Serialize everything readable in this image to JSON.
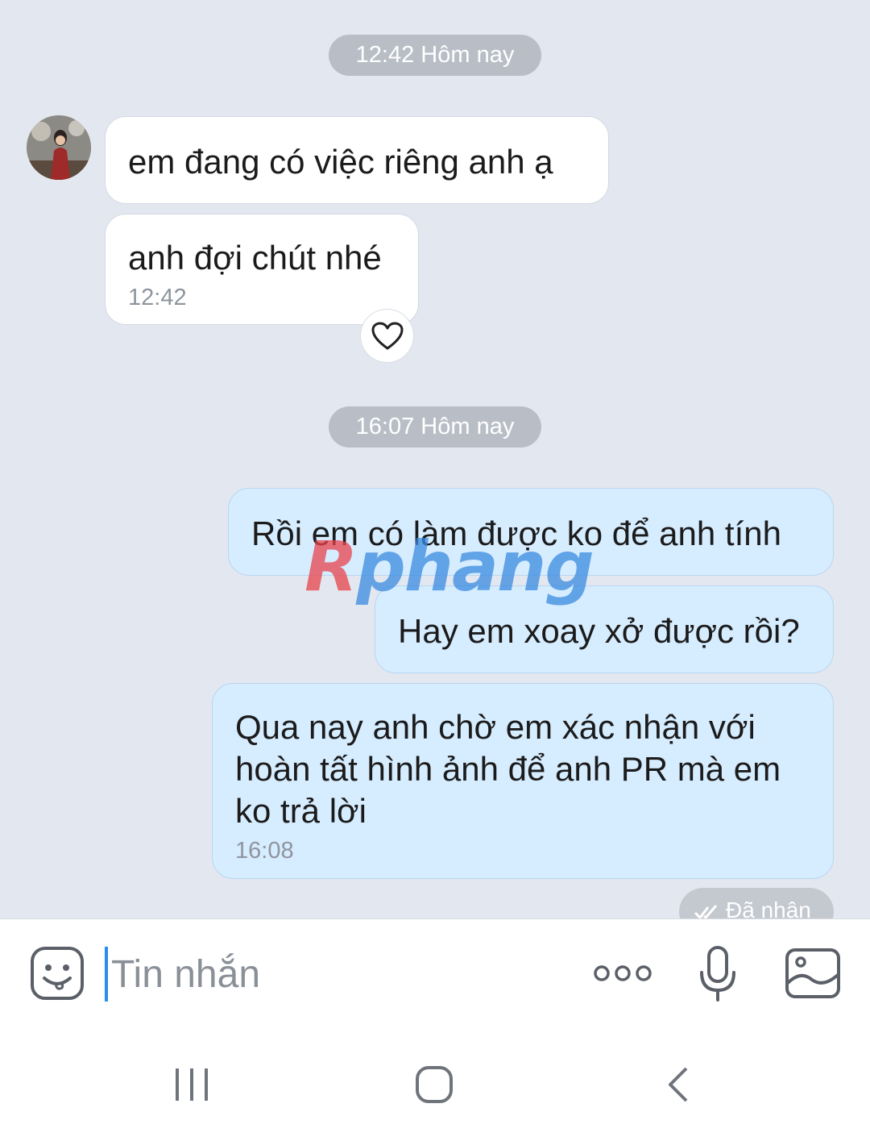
{
  "chat": {
    "separators": [
      {
        "label": "12:42 Hôm nay"
      },
      {
        "label": "16:07 Hôm nay"
      }
    ],
    "incoming": [
      {
        "text": "em đang có việc riêng anh ạ"
      },
      {
        "text": "anh đợi chút nhé",
        "time": "12:42"
      }
    ],
    "outgoing": [
      {
        "text": "Rồi em có làm được ko để anh tính"
      },
      {
        "text": "Hay em xoay xở được rồi?"
      },
      {
        "lines": [
          "Qua nay anh chờ em xác nhận với",
          "hoàn tất hình ảnh để anh PR mà em",
          "ko trả lời"
        ],
        "time": "16:08"
      }
    ],
    "status": "Đã nhận",
    "watermark": {
      "accent": "R",
      "rest": "phang"
    }
  },
  "composer": {
    "placeholder": "Tin nhắn",
    "icons": [
      "smiley-icon",
      "more-icon",
      "microphone-icon",
      "image-icon"
    ]
  },
  "navbar": {
    "icons": [
      "recent-apps-icon",
      "home-icon",
      "back-icon"
    ]
  },
  "colors": {
    "chat_background": "#e3e8f0",
    "incoming_bubble": "#ffffff",
    "outgoing_bubble": "#d6ecff",
    "cursor": "#2a8cf0"
  }
}
